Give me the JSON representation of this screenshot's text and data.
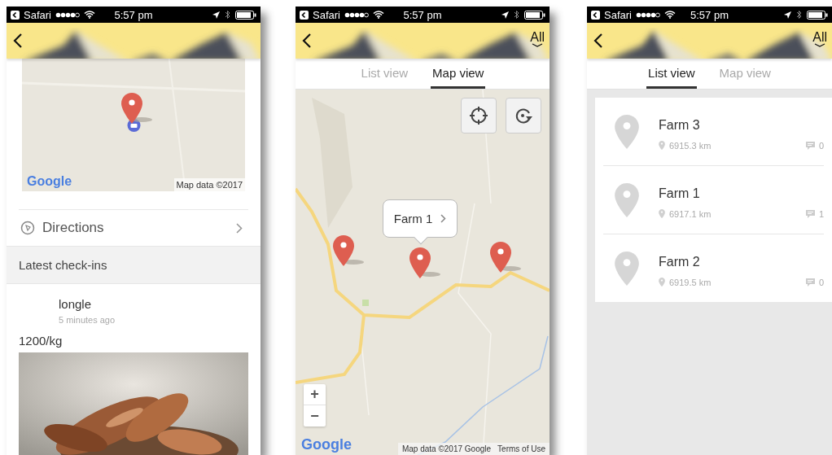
{
  "phones": [
    {
      "kind": "detail",
      "status_bar": {
        "app": "Safari",
        "time": "5:57 pm"
      },
      "map": {
        "logo": "Google",
        "attribution": "Map data ©2017"
      },
      "directions": "Directions",
      "section_title": "Latest check-ins",
      "checkin": {
        "user": "longle",
        "time": "5 minutes ago",
        "note": "1200/kg"
      }
    },
    {
      "kind": "map",
      "status_bar": {
        "app": "Safari",
        "time": "5:57 pm"
      },
      "header": {
        "filter": "All"
      },
      "tabs": [
        {
          "label": "List view",
          "selected": false
        },
        {
          "label": "Map view",
          "selected": true
        }
      ],
      "map": {
        "callout": "Farm 1",
        "zoom_in": "+",
        "zoom_out": "−",
        "logo": "Google",
        "attribution": "Map data ©2017 Google",
        "terms": "Terms of Use"
      }
    },
    {
      "kind": "list",
      "status_bar": {
        "app": "Safari",
        "time": "5:57 pm"
      },
      "header": {
        "filter": "All"
      },
      "tabs": [
        {
          "label": "List view",
          "selected": true
        },
        {
          "label": "Map view",
          "selected": false
        }
      ],
      "farms": [
        {
          "name": "Farm 3",
          "distance": "6915.3 km",
          "comments": "0"
        },
        {
          "name": "Farm 1",
          "distance": "6917.1 km",
          "comments": "1"
        },
        {
          "name": "Farm 2",
          "distance": "6919.5 km",
          "comments": "0"
        }
      ]
    }
  ]
}
